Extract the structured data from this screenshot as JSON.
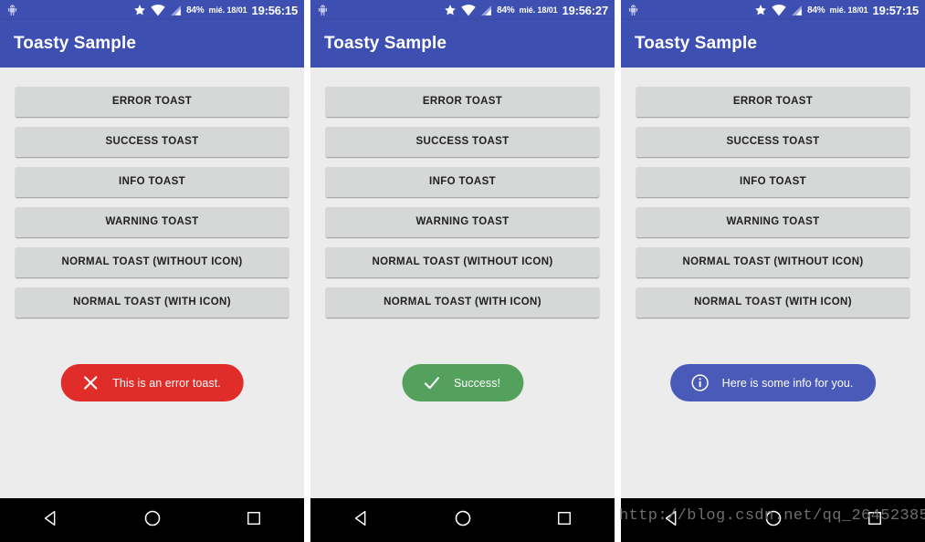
{
  "app": {
    "title": "Toasty Sample"
  },
  "status_bar": {
    "icons": [
      "android-droid-icon",
      "star-icon",
      "wifi-icon",
      "signal-icon"
    ],
    "battery": "84%",
    "date": "mié. 18/01"
  },
  "buttons": [
    {
      "label": "ERROR TOAST",
      "name": "error-toast-button"
    },
    {
      "label": "SUCCESS TOAST",
      "name": "success-toast-button"
    },
    {
      "label": "INFO TOAST",
      "name": "info-toast-button"
    },
    {
      "label": "WARNING TOAST",
      "name": "warning-toast-button"
    },
    {
      "label": "NORMAL TOAST (WITHOUT ICON)",
      "name": "normal-toast-without-icon-button"
    },
    {
      "label": "NORMAL TOAST (WITH ICON)",
      "name": "normal-toast-with-icon-button"
    }
  ],
  "panels": [
    {
      "time": "19:56:15",
      "toast": {
        "text": "This is an error toast.",
        "icon": "close-x-icon",
        "color": "#e12d29"
      }
    },
    {
      "time": "19:56:27",
      "toast": {
        "text": "Success!",
        "icon": "check-icon",
        "color": "#54a15e"
      }
    },
    {
      "time": "19:57:15",
      "toast": {
        "text": "Here is some info for you.",
        "icon": "info-circle-icon",
        "color": "#4a5ab9"
      }
    }
  ],
  "nav_bar": {
    "back": "back-triangle-icon",
    "home": "home-circle-icon",
    "recents": "recents-square-icon"
  },
  "watermark": "http://blog.csdn.net/qq_26452385",
  "theme": {
    "primary": "#3d4fb0",
    "content_bg": "#ececec",
    "button_bg": "#d6d7d7",
    "nav_bg": "#000000"
  }
}
